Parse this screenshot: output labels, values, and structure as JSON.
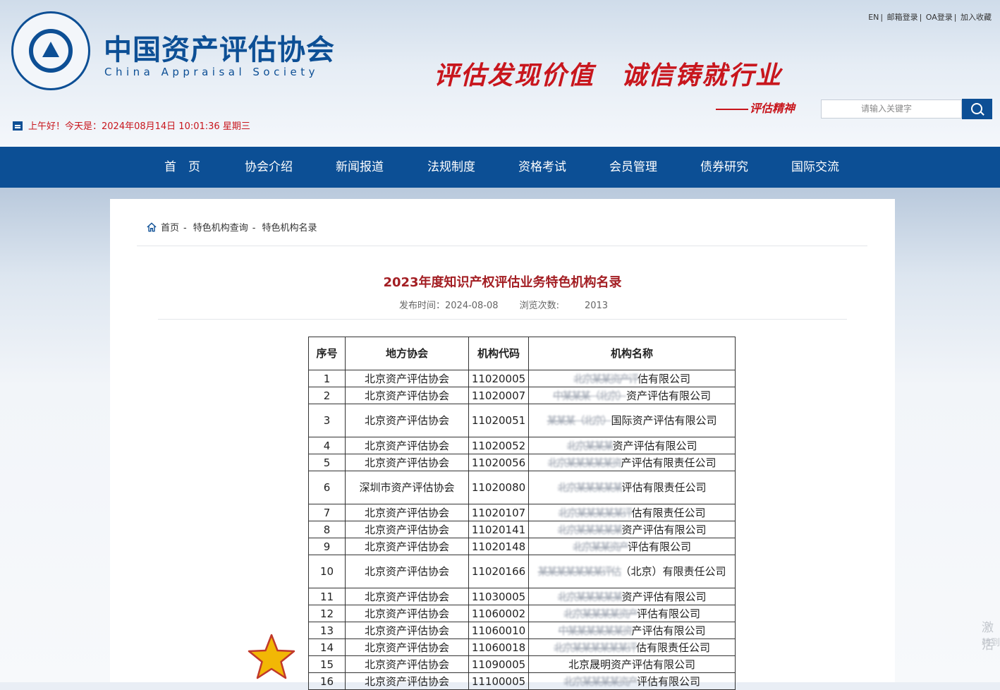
{
  "header": {
    "logo_cn": "中国资产评估协会",
    "logo_en": "China Appraisal Society",
    "slogan": "评估发现价值　诚信铸就行业",
    "slogan_sub": "评估精神",
    "top_links": [
      "EN",
      "邮箱登录",
      "OA登录",
      "加入收藏"
    ],
    "search_placeholder": "请输入关键字",
    "greeting": "上午好！今天是：2024年08月14日 10:01:36 星期三"
  },
  "nav": {
    "items": [
      "首　页",
      "协会介绍",
      "新闻报道",
      "法规制度",
      "资格考试",
      "会员管理",
      "债券研究",
      "国际交流"
    ]
  },
  "breadcrumb": {
    "home": "首页",
    "items": [
      "特色机构查询",
      "特色机构名录"
    ]
  },
  "article": {
    "title": "2023年度知识产权评估业务特色机构名录",
    "publish_label": "发布时间：",
    "publish_date": "2024-08-08",
    "views_label": "浏览次数:",
    "views": "2013"
  },
  "table": {
    "headers": [
      "序号",
      "地方协会",
      "机构代码",
      "机构名称"
    ],
    "rows": [
      {
        "no": "1",
        "assoc": "北京资产评估协会",
        "code": "11020005",
        "name_hidden": "北京某某资产评",
        "name_visible": "估有限公司"
      },
      {
        "no": "2",
        "assoc": "北京资产评估协会",
        "code": "11020007",
        "name_hidden": "中某某某（北京）",
        "name_visible": "资产评估有限公司"
      },
      {
        "no": "3",
        "assoc": "北京资产评估协会",
        "code": "11020051",
        "name_hidden": "某某某（北京）",
        "name_visible": "国际资产评估有限公司"
      },
      {
        "no": "4",
        "assoc": "北京资产评估协会",
        "code": "11020052",
        "name_hidden": "北京某某某",
        "name_visible": "资产评估有限公司"
      },
      {
        "no": "5",
        "assoc": "北京资产评估协会",
        "code": "11020056",
        "name_hidden": "北京某某某某某资",
        "name_visible": "产评估有限责任公司"
      },
      {
        "no": "6",
        "assoc": "深圳市资产评估协会",
        "code": "11020080",
        "name_hidden": "北京某某某某某",
        "name_visible": "评估有限责任公司"
      },
      {
        "no": "7",
        "assoc": "北京资产评估协会",
        "code": "11020107",
        "name_hidden": "北京某某某某某评",
        "name_visible": "估有限责任公司"
      },
      {
        "no": "8",
        "assoc": "北京资产评估协会",
        "code": "11020141",
        "name_hidden": "北京某某某某某",
        "name_visible": "资产评估有限公司"
      },
      {
        "no": "9",
        "assoc": "北京资产评估协会",
        "code": "11020148",
        "name_hidden": "北京某某资产",
        "name_visible": "评估有限公司"
      },
      {
        "no": "10",
        "assoc": "北京资产评估协会",
        "code": "11020166",
        "name_hidden": "某某某某某某某评估",
        "name_visible": "（北京）有限责任公司"
      },
      {
        "no": "11",
        "assoc": "北京资产评估协会",
        "code": "11030005",
        "name_hidden": "北京某某某某某",
        "name_visible": "资产评估有限公司"
      },
      {
        "no": "12",
        "assoc": "北京资产评估协会",
        "code": "11060002",
        "name_hidden": "北京某某某某资产",
        "name_visible": "评估有限公司"
      },
      {
        "no": "13",
        "assoc": "北京资产评估协会",
        "code": "11060010",
        "name_hidden": "中某某某某某某资",
        "name_visible": "产评估有限公司"
      },
      {
        "no": "14",
        "assoc": "北京资产评估协会",
        "code": "11060018",
        "name_hidden": "北京某某某某某某评",
        "name_visible": "估有限责任公司"
      },
      {
        "no": "15",
        "assoc": "北京资产评估协会",
        "code": "11090005",
        "name_hidden": "",
        "name_visible": "北京晟明资产评估有限公司"
      },
      {
        "no": "16",
        "assoc": "北京资产评估协会",
        "code": "11100005",
        "name_hidden": "北京某某某某资产",
        "name_visible": "评估有限公司"
      }
    ]
  },
  "side_text": {
    "line1": "激活",
    "line2": "转到"
  },
  "colors": {
    "brand_blue": "#0c4f95",
    "accent_red": "#c8161d",
    "title_red": "#a31e23",
    "star": "#f2b705"
  }
}
